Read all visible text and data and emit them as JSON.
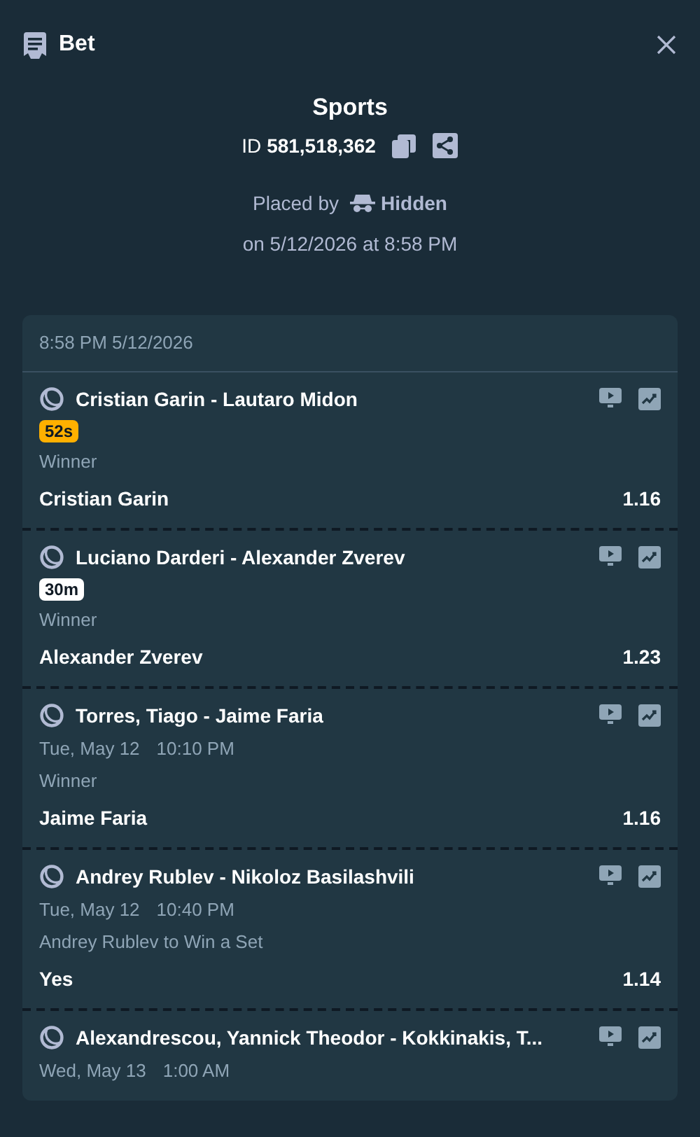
{
  "header": {
    "title": "Bet"
  },
  "summary": {
    "category": "Sports",
    "id_label": "ID",
    "id_value": "581,518,362",
    "placed_by_label": "Placed by",
    "placed_by_user": "Hidden",
    "placed_on": "on 5/12/2026 at 8:58 PM"
  },
  "slip": {
    "timestamp": "8:58 PM 5/12/2026",
    "legs": [
      {
        "event": "Cristian Garin - Lautaro Midon",
        "badge": {
          "kind": "live",
          "text": "52s"
        },
        "market": "Winner",
        "selection": "Cristian Garin",
        "odds": "1.16"
      },
      {
        "event": "Luciano Darderi - Alexander Zverev",
        "badge": {
          "kind": "soon",
          "text": "30m"
        },
        "market": "Winner",
        "selection": "Alexander Zverev",
        "odds": "1.23"
      },
      {
        "event": "Torres, Tiago - Jaime Faria",
        "date": "Tue, May 12",
        "time": "10:10 PM",
        "market": "Winner",
        "selection": "Jaime Faria",
        "odds": "1.16"
      },
      {
        "event": "Andrey Rublev - Nikoloz Basilashvili",
        "date": "Tue, May 12",
        "time": "10:40 PM",
        "market": "Andrey Rublev to Win a Set",
        "selection": "Yes",
        "odds": "1.14"
      },
      {
        "event": "Alexandrescou, Yannick Theodor - Kokkinakis, T...",
        "date": "Wed, May 13",
        "time": "1:00 AM"
      }
    ]
  }
}
